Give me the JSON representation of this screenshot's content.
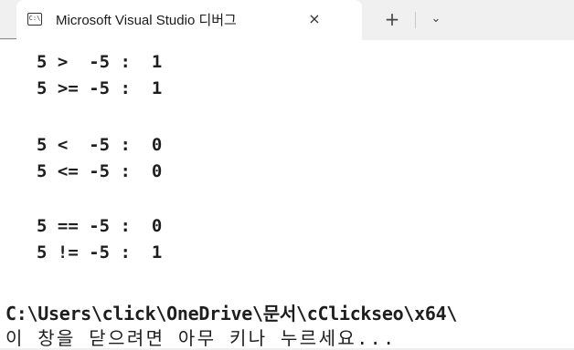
{
  "tab": {
    "title": "Microsoft Visual Studio 디버그",
    "close_label": "×",
    "icon": "console-icon",
    "icon_glyph": "C:\\"
  },
  "tabbar": {
    "new_tab_label": "+",
    "dropdown_label": "⌄"
  },
  "console": {
    "output_lines": [
      "5 >  -5 :  1",
      "5 >= -5 :  1",
      "5 <  -5 :  0",
      "5 <= -5 :  0",
      "5 == -5 :  0",
      "5 != -5 :  1"
    ],
    "path_line": "C:\\Users\\click\\OneDrive\\문서\\cClickseo\\x64\\",
    "prompt_line": "이 창을 닫으려면 아무 키나 누르세요..."
  }
}
